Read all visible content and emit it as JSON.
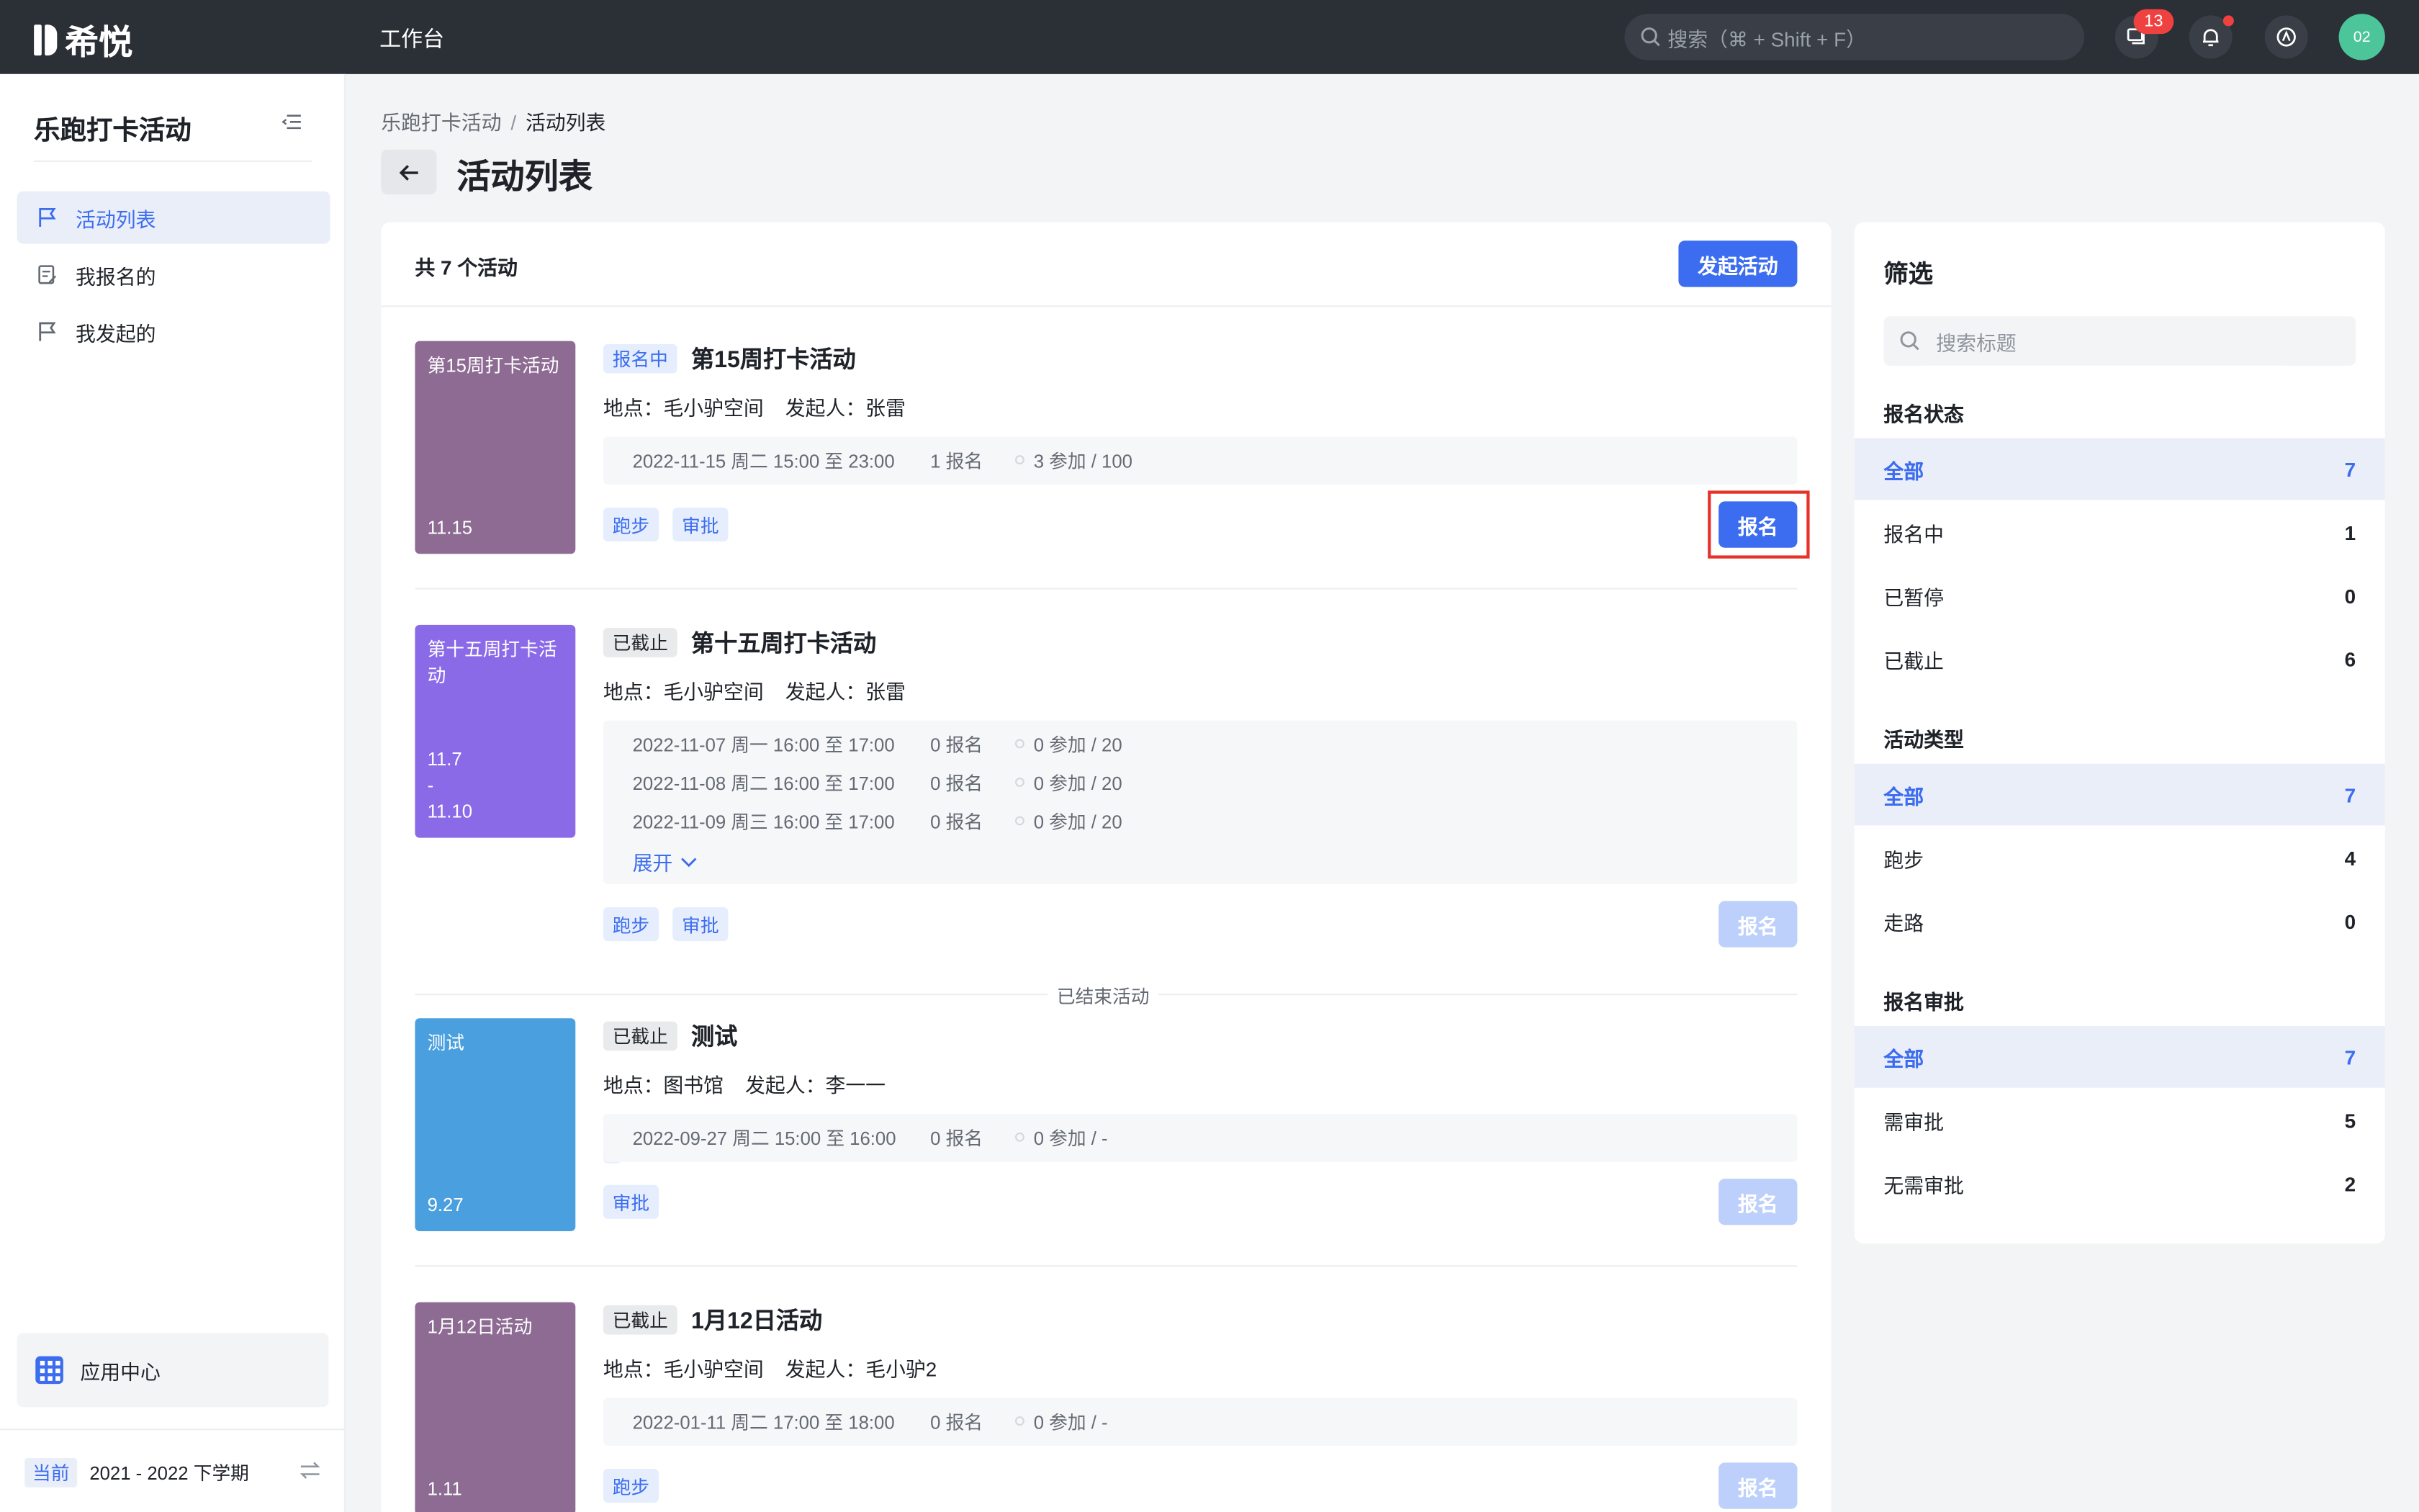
{
  "topbar": {
    "logo_text": "希悦",
    "nav_label": "工作台",
    "search_placeholder": "搜索（⌘ + Shift + F）",
    "message_badge": "13",
    "avatar_text": "02"
  },
  "sidebar": {
    "title": "乐跑打卡活动",
    "items": [
      {
        "label": "活动列表",
        "icon": "flag-icon",
        "active": true
      },
      {
        "label": "我报名的",
        "icon": "form-icon",
        "active": false
      },
      {
        "label": "我发起的",
        "icon": "flag-icon",
        "active": false
      }
    ],
    "app_center": "应用中心",
    "term_tag": "当前",
    "term_value": "2021 - 2022 下学期"
  },
  "breadcrumb": {
    "root": "乐跑打卡活动",
    "separator": "/",
    "current": "活动列表"
  },
  "page": {
    "title": "活动列表"
  },
  "list": {
    "count_text": "共 7 个活动",
    "create_button": "发起活动",
    "ended_divider": "已结束活动",
    "activities": [
      {
        "cover_name": "第15周打卡活动",
        "cover_date": "11.15",
        "cover_color": "#8d6b93",
        "status": "报名中",
        "name": "第15周打卡活动",
        "location": "地点：毛小驴空间",
        "organizer": "发起人：张雷",
        "sessions": [
          {
            "time": "2022-11-15 周二 15:00 至 23:00",
            "signups": "1 报名",
            "attend": "3 参加 / 100"
          }
        ],
        "expand_label": "",
        "tags": [
          "跑步",
          "审批"
        ],
        "join_label": "报名",
        "join_enabled": true
      },
      {
        "cover_name": "第十五周打卡活动",
        "cover_date": "11.7\n-\n11.10",
        "cover_color": "#8b6ae8",
        "status": "已截止",
        "name": "第十五周打卡活动",
        "location": "地点：毛小驴空间",
        "organizer": "发起人：张雷",
        "sessions": [
          {
            "time": "2022-11-07 周一 16:00 至 17:00",
            "signups": "0 报名",
            "attend": "0 参加 / 20"
          },
          {
            "time": "2022-11-08 周二 16:00 至 17:00",
            "signups": "0 报名",
            "attend": "0 参加 / 20"
          },
          {
            "time": "2022-11-09 周三 16:00 至 17:00",
            "signups": "0 报名",
            "attend": "0 参加 / 20"
          }
        ],
        "expand_label": "展开",
        "tags": [
          "跑步",
          "审批"
        ],
        "join_label": "报名",
        "join_enabled": false
      },
      {
        "cover_name": "测试",
        "cover_date": "9.27",
        "cover_color": "#4a9fde",
        "status": "已截止",
        "name": "测试",
        "location": "地点：图书馆",
        "organizer": "发起人：李一一",
        "sessions": [
          {
            "time": "2022-09-27 周二 15:00 至 16:00",
            "signups": "0 报名",
            "attend": "0 参加 / -"
          }
        ],
        "expand_label": "",
        "tags": [
          "审批"
        ],
        "join_label": "报名",
        "join_enabled": false
      },
      {
        "cover_name": "1月12日活动",
        "cover_date": "1.11",
        "cover_color": "#8d6b93",
        "status": "已截止",
        "name": "1月12日活动",
        "location": "地点：毛小驴空间",
        "organizer": "发起人：毛小驴2",
        "sessions": [
          {
            "time": "2022-01-11 周二 17:00 至 18:00",
            "signups": "0 报名",
            "attend": "0 参加 / -"
          }
        ],
        "expand_label": "",
        "tags": [
          "跑步"
        ],
        "join_label": "报名",
        "join_enabled": false
      }
    ]
  },
  "filter": {
    "title": "筛选",
    "search_placeholder": "搜索标题",
    "sections": [
      {
        "title": "报名状态",
        "options": [
          {
            "label": "全部",
            "count": "7",
            "active": true
          },
          {
            "label": "报名中",
            "count": "1",
            "active": false
          },
          {
            "label": "已暂停",
            "count": "0",
            "active": false
          },
          {
            "label": "已截止",
            "count": "6",
            "active": false
          }
        ]
      },
      {
        "title": "活动类型",
        "options": [
          {
            "label": "全部",
            "count": "7",
            "active": true
          },
          {
            "label": "跑步",
            "count": "4",
            "active": false
          },
          {
            "label": "走路",
            "count": "0",
            "active": false
          }
        ]
      },
      {
        "title": "报名审批",
        "options": [
          {
            "label": "全部",
            "count": "7",
            "active": true
          },
          {
            "label": "需审批",
            "count": "5",
            "active": false
          },
          {
            "label": "无需审批",
            "count": "2",
            "active": false
          }
        ]
      }
    ]
  },
  "colors": {
    "accent": "#3c6df0",
    "topbar": "#2b2f36",
    "badge": "#f04141",
    "highlight": "#e6332a"
  }
}
